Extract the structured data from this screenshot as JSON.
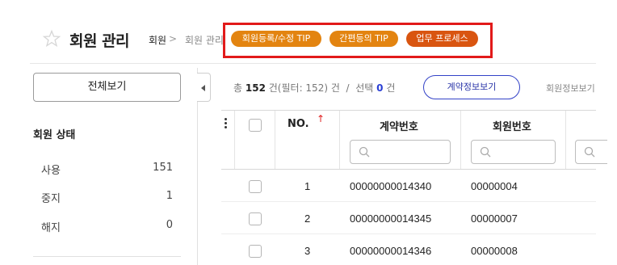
{
  "header": {
    "title": "회원 관리",
    "breadcrumb": [
      "회원",
      "회원 관리"
    ],
    "breadcrumb_separator": ">"
  },
  "tips": [
    {
      "label": "회원등록/수정 TIP",
      "color": "#e38410"
    },
    {
      "label": "간편등의 TIP",
      "color": "#e38410"
    },
    {
      "label": "업무 프로세스",
      "color": "#d95510"
    }
  ],
  "sidebar": {
    "view_all_label": "전체보기",
    "status_title": "회원 상태",
    "statuses": [
      {
        "label": "사용",
        "count": "151"
      },
      {
        "label": "중지",
        "count": "1"
      },
      {
        "label": "해지",
        "count": "0"
      }
    ]
  },
  "summary": {
    "total_prefix": "총",
    "total": "152",
    "total_suffix": "건(필터: 152) 건",
    "divider": "/",
    "selected_prefix": "선택",
    "selected": "0",
    "selected_suffix": "건"
  },
  "tabs": [
    {
      "label": "계약정보보기",
      "active": true
    },
    {
      "label": "회원정보보기",
      "active": false
    }
  ],
  "table": {
    "columns": [
      "NO.",
      "계약번호",
      "회원번호"
    ],
    "sort_indicator": "↑",
    "rows": [
      {
        "no": "1",
        "contract": "00000000014340",
        "member": "00000004"
      },
      {
        "no": "2",
        "contract": "00000000014345",
        "member": "00000007"
      },
      {
        "no": "3",
        "contract": "00000000014346",
        "member": "00000008"
      }
    ]
  },
  "colors": {
    "accent": "#3342c7",
    "highlight_border": "#e21a1a",
    "tip_orange": "#e38410",
    "tip_dark_orange": "#d95510"
  },
  "icons": [
    "star-icon",
    "chevron-left-icon",
    "search-icon",
    "kebab-menu-icon"
  ]
}
